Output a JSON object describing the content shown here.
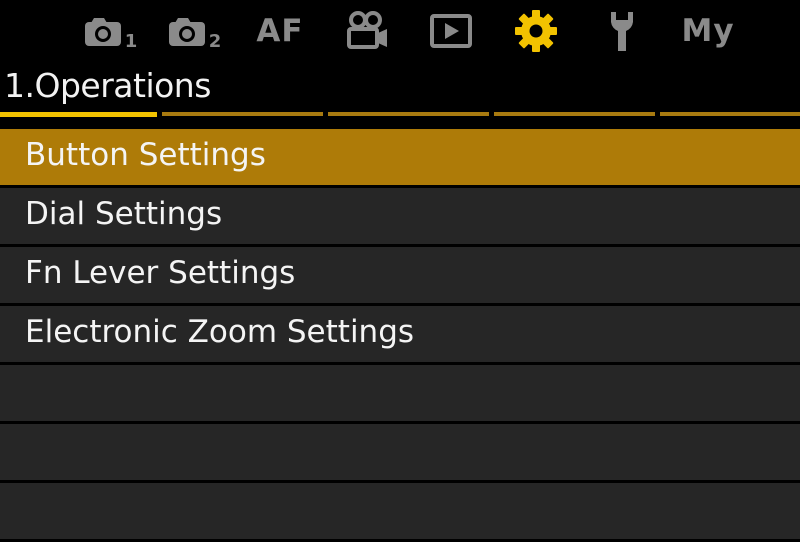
{
  "tabs": [
    {
      "icon": "camera-icon",
      "sub": "1"
    },
    {
      "icon": "camera-icon",
      "sub": "2"
    },
    {
      "text": "AF"
    },
    {
      "icon": "video-camera-icon"
    },
    {
      "icon": "playback-icon"
    },
    {
      "icon": "gear-icon",
      "active": true,
      "color": "#f2c200"
    },
    {
      "icon": "wrench-icon"
    },
    {
      "text": "My"
    }
  ],
  "section": {
    "title": "1.Operations"
  },
  "pages": {
    "count": 5,
    "current": 1
  },
  "menu": {
    "items": [
      {
        "label": "Button Settings",
        "selected": true
      },
      {
        "label": "Dial Settings"
      },
      {
        "label": "Fn Lever Settings"
      },
      {
        "label": "Electronic Zoom Settings"
      },
      {
        "label": ""
      },
      {
        "label": ""
      },
      {
        "label": ""
      }
    ]
  },
  "colors": {
    "accent": "#f2c200",
    "selected_row": "#ae7b08",
    "row": "#262626",
    "inactive_icon": "#8a8a8a"
  }
}
